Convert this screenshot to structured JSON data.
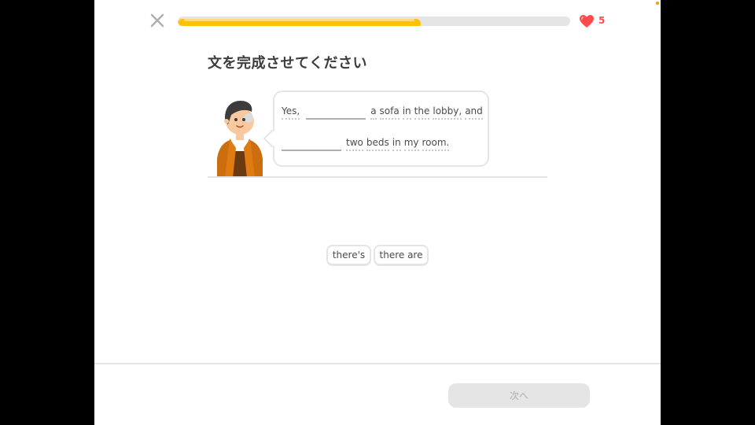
{
  "header": {
    "close_icon": "close-x-icon",
    "progress_fraction": 0.62,
    "progress_color": "#fcc203",
    "heart_icon": "heart-icon",
    "heart_color": "#ff4b4b",
    "hearts_count": "5"
  },
  "prompt": {
    "title": "文を完成させてください"
  },
  "sentence": {
    "line1": [
      "Yes,",
      "a",
      "sofa",
      "in",
      "the",
      "lobby,",
      "and"
    ],
    "line2": [
      "two",
      "beds",
      "in",
      "my",
      "room."
    ]
  },
  "word_bank": {
    "tile1": "there's",
    "tile2": "there are"
  },
  "footer": {
    "next_label": "次へ"
  }
}
